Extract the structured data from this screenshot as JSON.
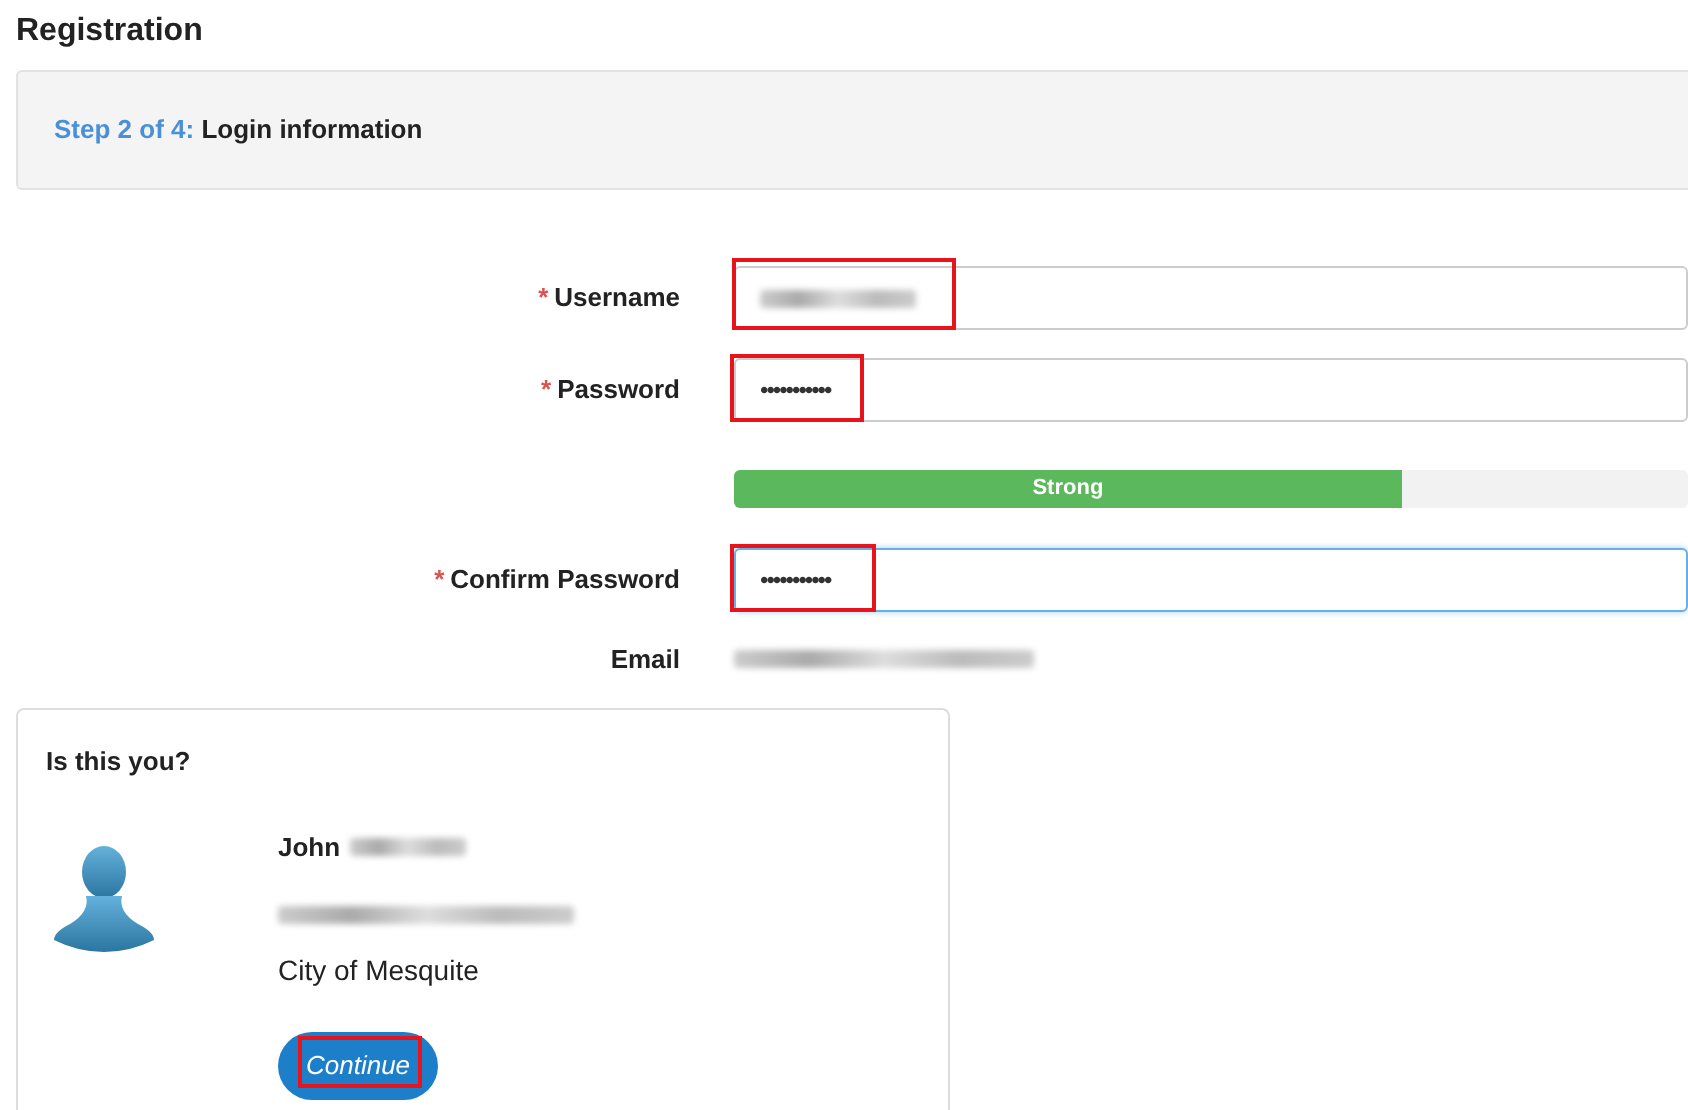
{
  "page_title": "Registration",
  "step": {
    "prefix": "Step 2 of 4:",
    "title": "Login information"
  },
  "fields": [
    {
      "kind": "input",
      "label": "Username",
      "required_marker": "*",
      "redacted": true,
      "focused": false,
      "highlighted": true
    },
    {
      "kind": "input",
      "label": "Password",
      "required_marker": "*",
      "value": "•••••••••••",
      "focused": false,
      "highlighted": true
    },
    {
      "kind": "meter",
      "label_text": "Strong",
      "level": 0.7
    },
    {
      "kind": "input",
      "label": "Confirm Password",
      "required_marker": "*",
      "value": "•••••••••••",
      "focused": true,
      "highlighted": true
    },
    {
      "kind": "static",
      "label": "Email",
      "redacted": true
    }
  ],
  "match_card": {
    "title": "Is this you?",
    "first_name": "John",
    "surname_redacted": true,
    "email_redacted": true,
    "organization": "City of Mesquite",
    "button": {
      "label": "Continue",
      "highlighted": true
    }
  }
}
